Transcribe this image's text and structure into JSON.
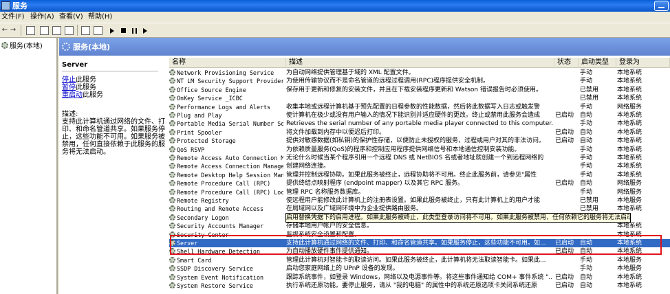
{
  "window": {
    "title": "服务"
  },
  "menu": [
    "文件(F)",
    "操作(A)",
    "查看(V)",
    "帮助(H)"
  ],
  "tree": {
    "root": "服务(本地)"
  },
  "header": {
    "title": "服务(本地)"
  },
  "extended": {
    "service_name": "Server",
    "actions": [
      {
        "link": "停止",
        "suffix": "此服务"
      },
      {
        "link": "暂停",
        "suffix": "此服务"
      },
      {
        "link": "重启动",
        "suffix": "此服务"
      }
    ],
    "desc_label": "描述:",
    "desc_text": "支持此计算机通过网络的文件、打印、和命名管道共享。如果服务停止，这些功能不可用。如果服务被禁用，任何直接依赖于此服务的服务将无法启动。"
  },
  "columns": {
    "name": "名称",
    "desc": "描述",
    "status": "状态",
    "start": "启动类型",
    "logon": "登录为"
  },
  "rows": [
    {
      "name": "Network Provisioning Service",
      "desc": "为自动网络提供管理基于域的 XML 配置文件。",
      "status": "",
      "start": "手动",
      "logon": "本地系统"
    },
    {
      "name": "NT LM Security Support Provider",
      "desc": "为使用传输协议而不是命名管道的远程过程调用(RPC)程序提供安全机制。",
      "status": "",
      "start": "手动",
      "logon": "本地系统"
    },
    {
      "name": "Office Source Engine",
      "desc": "保存用于更新和修复的安装文件，并且在下载安装程序更新和 Watson 错误报告时必须使用。",
      "status": "",
      "start": "已禁用",
      "logon": "本地系统"
    },
    {
      "name": "OnKey Service _ICBC",
      "desc": "",
      "status": "",
      "start": "已禁用",
      "logon": "本地系统"
    },
    {
      "name": "Performance Logs and Alerts",
      "desc": "收集本地或远程计算机基于预先配置的日程参数的性能数据，然后将此数据写入日志或触发警",
      "status": "",
      "start": "手动",
      "logon": "网络服务"
    },
    {
      "name": "Plug and Play",
      "desc": "使计算机在极少或没有用户输入的情况下能识别并适应硬件的更改。终止或禁用此服务会造成",
      "status": "已启动",
      "start": "自动",
      "logon": "本地系统"
    },
    {
      "name": "Portable Media Serial Number Se...",
      "desc": "Retrieves the serial number of any portable media player connected to this computer...",
      "status": "",
      "start": "手动",
      "logon": "本地系统"
    },
    {
      "name": "Print Spooler",
      "desc": "将文件加载到内存中以便迟后打印。",
      "status": "已启动",
      "start": "自动",
      "logon": "本地系统"
    },
    {
      "name": "Protected Storage",
      "desc": "提供对敏感数据(如私钥)的保护性存储，以便防止未授权的服务，过程或用户对其的非法访问。",
      "status": "已启动",
      "start": "自动",
      "logon": "本地系统"
    },
    {
      "name": "QoS RSVP",
      "desc": "为依赖质量服务(QoS)的程序和控制应用程序提供网络信号和本地通信控制安装功能。",
      "status": "",
      "start": "手动",
      "logon": "本地系统"
    },
    {
      "name": "Remote Access Auto Connection M...",
      "desc": "无论什么时候当某个程序引用一个远程 DNS 或 NetBIOS 名或者地址就创建一个到远程网络的",
      "status": "",
      "start": "手动",
      "logon": "本地系统"
    },
    {
      "name": "Remote Access Connection Manager",
      "desc": "创建网络连接。",
      "status": "",
      "start": "手动",
      "logon": "本地系统"
    },
    {
      "name": "Remote Desktop Help Session Man...",
      "desc": "管理并控制远程协助。如果此服务被终止，远程协助将不可用。终止此服务前，请参见\"属性",
      "status": "",
      "start": "手动",
      "logon": "本地系统"
    },
    {
      "name": "Remote Procedure Call (RPC)",
      "desc": "提供终结点映射程序 (endpoint mapper) 以及其它 RPC 服务。",
      "status": "已启动",
      "start": "自动",
      "logon": "网络服务"
    },
    {
      "name": "Remote Procedure Call (RPC) Loc...",
      "desc": "管理 RPC 名称服务数据库。",
      "status": "",
      "start": "手动",
      "logon": "网络服务"
    },
    {
      "name": "Remote Registry",
      "desc": "使远程用户能修改此计算机上的注册表设置。如果此服务被终止，只有此计算机上的用户才能",
      "status": "",
      "start": "已禁用",
      "logon": "本地服务"
    },
    {
      "name": "Routing and Remote Access",
      "desc": "在局域网以及广域网环境中为企业提供路由服务。",
      "status": "",
      "start": "已禁用",
      "logon": "本地系统"
    },
    {
      "name": "Secondary Logon",
      "desc": "启用替换凭据下的启用进程。如果此服务被终止，此类型登录访问将不可用。如果此服务被禁用，任何依赖它的服务将无法启动。",
      "status": "",
      "start": "",
      "logon": "",
      "tooltip": true
    },
    {
      "name": "Security Accounts Manager",
      "desc": "存储本地用户帐户的安全信息。",
      "status": "",
      "start": "",
      "logon": "本地系统"
    },
    {
      "name": "Security Center",
      "desc": "监视系统安全设置和配置。",
      "status": "",
      "start": "",
      "logon": "本地系统"
    },
    {
      "name": "Server",
      "desc": "支持此计算机通过网络的文件、打印、和命名管道共享。如果服务停止，这些功能不可用。如...",
      "status": "已启动",
      "start": "自动",
      "logon": "本地系统",
      "selected": true
    },
    {
      "name": "Shell Hardware Detection",
      "desc": "为自动播放硬件事件提供通知。",
      "status": "已启动",
      "start": "自动",
      "logon": "本地系统"
    },
    {
      "name": "Smart Card",
      "desc": "管理此计算机对智能卡的取读访问。如果此服务被终止，此计算机将无法取读智能卡。如果此...",
      "status": "",
      "start": "手动",
      "logon": "本地服务"
    },
    {
      "name": "SSDP Discovery Service",
      "desc": "启动您家庭网络上的 UPnP 设备的发现。",
      "status": "",
      "start": "手动",
      "logon": "本地服务"
    },
    {
      "name": "System Event Notification",
      "desc": "跟踪系统事件，如登录 Windows，网络以及电源事件等。将这些事件通知给 COM+ 事件系统 \"...",
      "status": "已启动",
      "start": "自动",
      "logon": "本地系统"
    },
    {
      "name": "System Restore Service",
      "desc": "执行系统还原功能。要停止服务，请从 \"我的电脑\" 的属性中的系统还原选项卡关闭系统还原",
      "status": "已启动",
      "start": "自动",
      "logon": "本地系统"
    }
  ]
}
